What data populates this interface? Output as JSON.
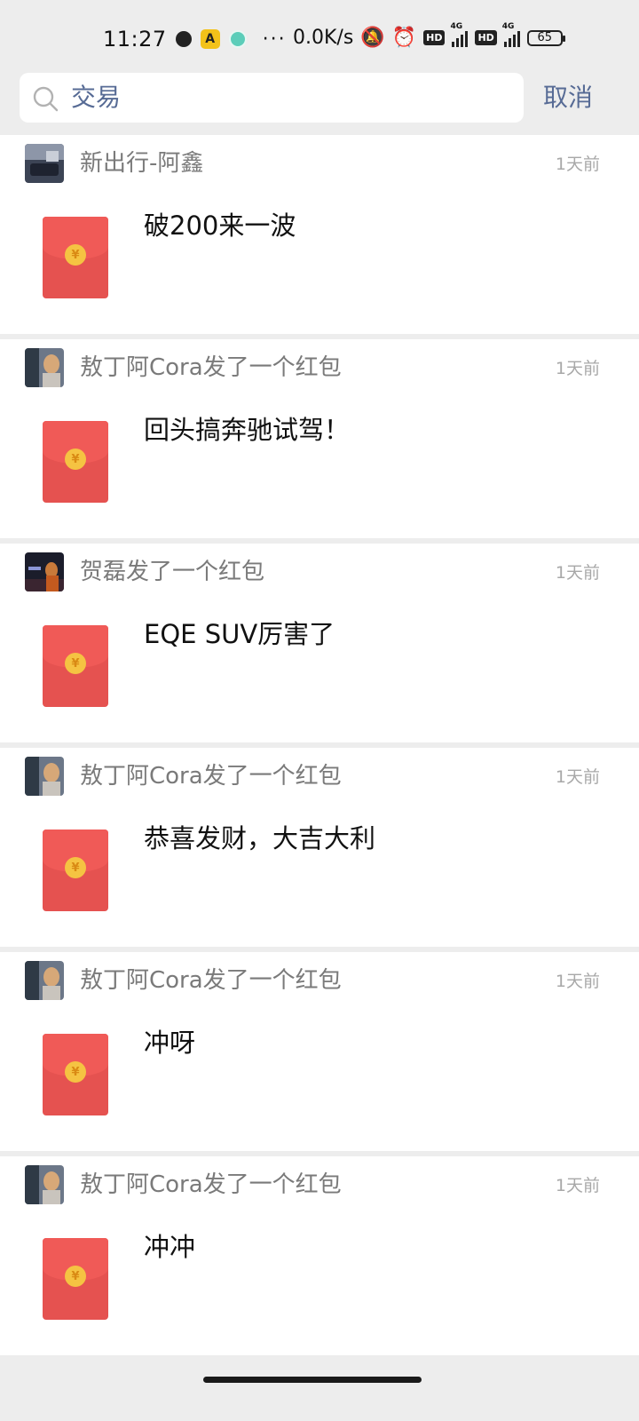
{
  "status_bar": {
    "time": "11:27",
    "more": "···",
    "net_speed": "0.0K/s",
    "hd1": "HD",
    "hd2": "HD",
    "net1": "4G",
    "net2": "4G",
    "battery": "65"
  },
  "search": {
    "query": "交易",
    "cancel_label": "取消"
  },
  "colors": {
    "link_blue": "#576b95",
    "envelope_red": "#e55250",
    "coin_gold": "#f5c342"
  },
  "feed": [
    {
      "title": "新出行-阿鑫",
      "time": "1天前",
      "message": "破200来一波",
      "avatar": "avatar-dark-car"
    },
    {
      "title": "敖丁阿Cora发了一个红包",
      "time": "1天前",
      "message": "回头搞奔驰试驾！",
      "avatar": "avatar-girl"
    },
    {
      "title": "贺磊发了一个红包",
      "time": "1天前",
      "message": "EQE SUV厉害了",
      "avatar": "avatar-man-stage"
    },
    {
      "title": "敖丁阿Cora发了一个红包",
      "time": "1天前",
      "message": "恭喜发财，大吉大利",
      "avatar": "avatar-girl"
    },
    {
      "title": "敖丁阿Cora发了一个红包",
      "time": "1天前",
      "message": "冲呀",
      "avatar": "avatar-girl"
    },
    {
      "title": "敖丁阿Cora发了一个红包",
      "time": "1天前",
      "message": "冲冲",
      "avatar": "avatar-girl"
    }
  ],
  "envelope_symbol": "¥"
}
